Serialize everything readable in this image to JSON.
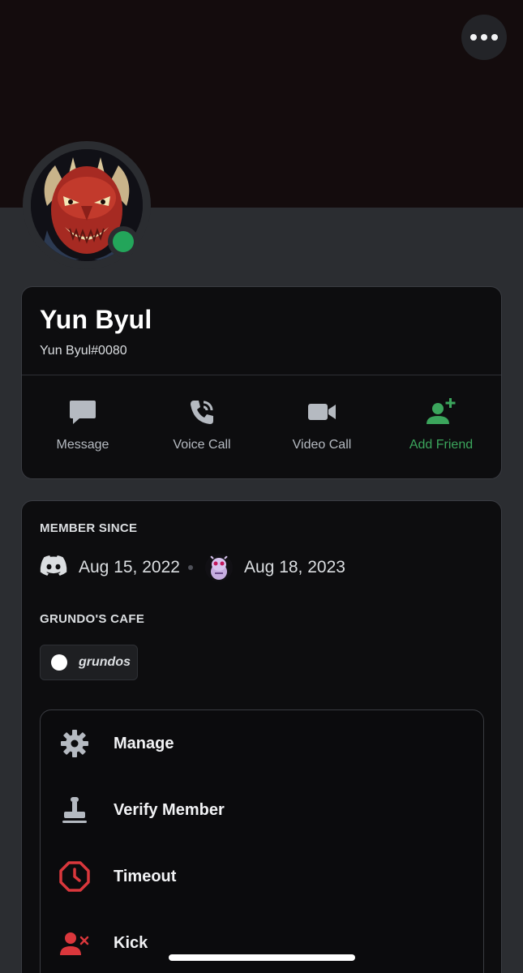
{
  "profile": {
    "display_name": "Yun Byul",
    "username": "Yun Byul#0080",
    "status": "online"
  },
  "actions": [
    {
      "label": "Message",
      "icon": "message-icon"
    },
    {
      "label": "Voice Call",
      "icon": "phone-icon"
    },
    {
      "label": "Video Call",
      "icon": "video-camera-icon"
    },
    {
      "label": "Add Friend",
      "icon": "add-friend-icon"
    }
  ],
  "member_since": {
    "title": "MEMBER SINCE",
    "discord_date": "Aug 15, 2022",
    "server_date": "Aug 18, 2023"
  },
  "server": {
    "title": "GRUNDO'S CAFE",
    "role": "grundos"
  },
  "menu": [
    {
      "label": "Manage",
      "icon": "gear-icon"
    },
    {
      "label": "Verify Member",
      "icon": "stamp-icon"
    },
    {
      "label": "Timeout",
      "icon": "timeout-clock-icon"
    },
    {
      "label": "Kick",
      "icon": "kick-user-icon"
    }
  ],
  "colors": {
    "online": "#23a55a",
    "add_friend": "#3ba55c",
    "danger": "#da373c"
  }
}
